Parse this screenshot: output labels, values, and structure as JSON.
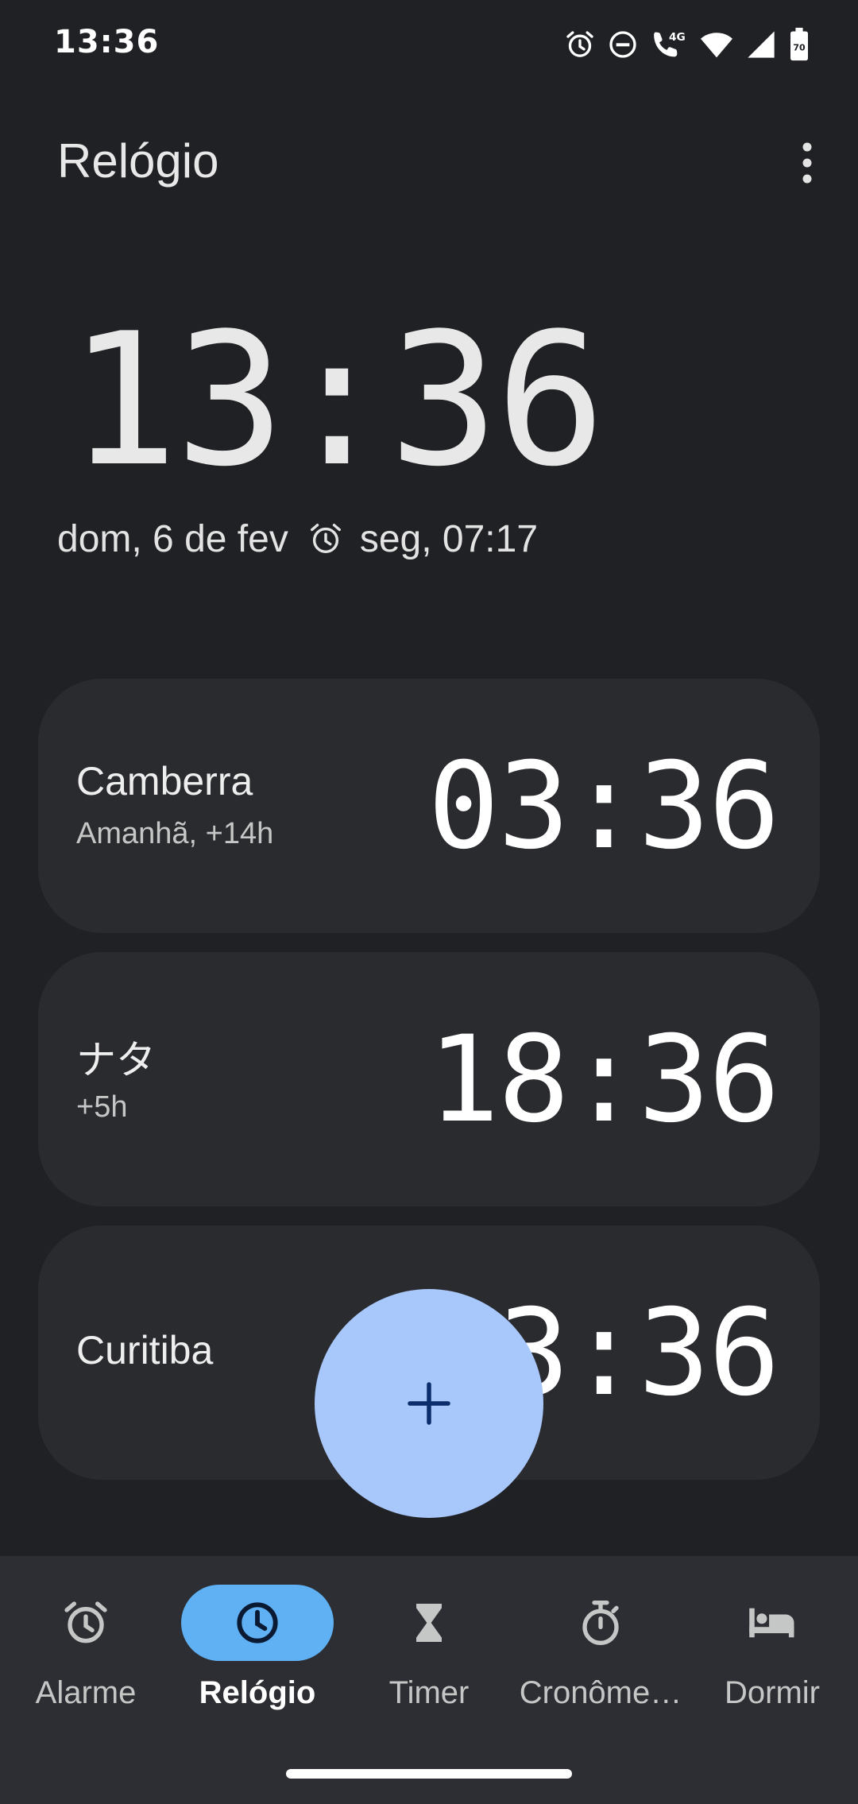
{
  "status_bar": {
    "time": "13:36",
    "network": "4G",
    "battery": "70"
  },
  "app_bar": {
    "title": "Relógio"
  },
  "main_clock": {
    "time": "13:36",
    "date": "dom, 6 de fev",
    "next_alarm": "seg, 07:17"
  },
  "cities": [
    {
      "name": "Camberra",
      "offset": "Amanhã, +14h",
      "time": "03:36"
    },
    {
      "name": "ナタ",
      "offset": "+5h",
      "time": "18:36"
    },
    {
      "name": "Curitiba",
      "offset": "",
      "time": "13:36"
    }
  ],
  "fab": {
    "icon": "plus-icon"
  },
  "bottom_nav": {
    "items": [
      {
        "label": "Alarme",
        "icon": "alarm-icon",
        "active": false
      },
      {
        "label": "Relógio",
        "icon": "clock-icon",
        "active": true
      },
      {
        "label": "Timer",
        "icon": "hourglass-icon",
        "active": false
      },
      {
        "label": "Cronôme…",
        "icon": "stopwatch-icon",
        "active": false
      },
      {
        "label": "Dormir",
        "icon": "bed-icon",
        "active": false
      }
    ]
  },
  "colors": {
    "background": "#202124",
    "card": "#2a2b2f",
    "fab": "#a8c7fa",
    "nav_active": "#5fb1f3",
    "nav_background": "#2d2e33"
  }
}
